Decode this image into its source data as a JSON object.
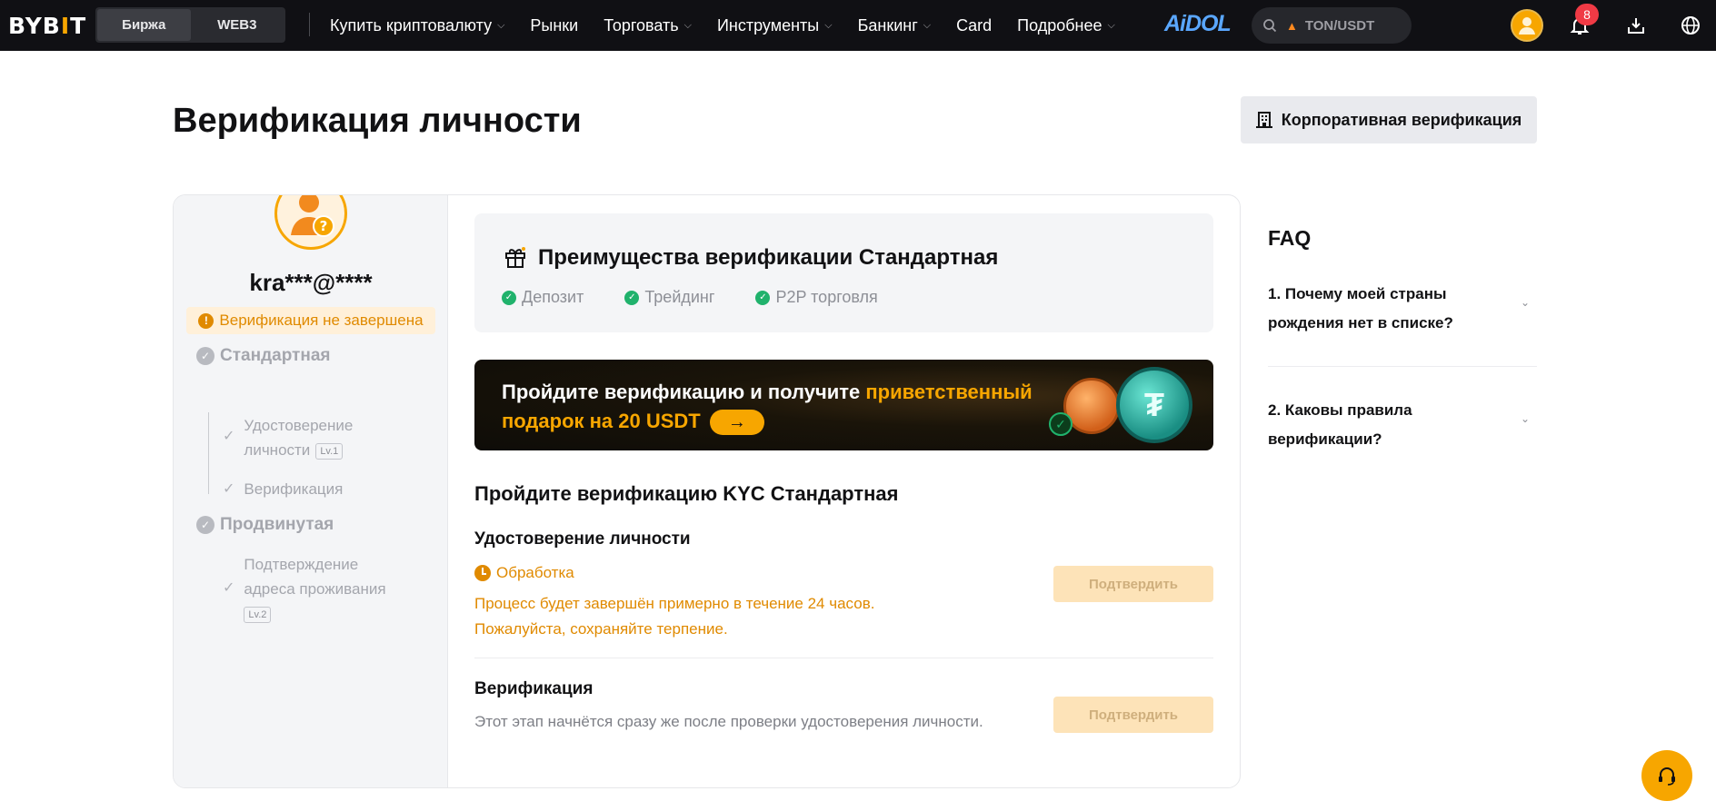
{
  "topbar": {
    "logo_left": "BYB",
    "logo_mark": "I",
    "logo_right": "T",
    "segment": [
      "Биржа",
      "WEB3"
    ],
    "nav": [
      {
        "label": "Купить криптовалюту",
        "has_menu": true
      },
      {
        "label": "Рынки",
        "has_menu": false
      },
      {
        "label": "Торговать",
        "has_menu": true
      },
      {
        "label": "Инструменты",
        "has_menu": true
      },
      {
        "label": "Банкинг",
        "has_menu": true
      },
      {
        "label": "Card",
        "has_menu": false
      },
      {
        "label": "Подробнее",
        "has_menu": true
      }
    ],
    "aidol": "AiDOL",
    "search_value": "TON/USDT",
    "notification_count": "8"
  },
  "page": {
    "title": "Верификация личности",
    "corporate_button": "Корпоративная верификация"
  },
  "sidebar": {
    "username": "kra***@****",
    "status": "Верификация не завершена",
    "levels": [
      {
        "label": "Стандартная"
      },
      {
        "label": "Продвинутая"
      }
    ],
    "substeps": {
      "identity_line1": "Удостоверение",
      "identity_line2": "личности",
      "identity_badge": "Lv.1",
      "verification": "Верификация",
      "address_line1": "Подтверждение",
      "address_line2": "адреса проживания",
      "address_badge": "Lv.2"
    }
  },
  "benefits": {
    "title": "Преимущества верификации Стандартная",
    "perks": [
      "Депозит",
      "Трейдинг",
      "P2P торговля"
    ]
  },
  "promo": {
    "text_plain": "Пройдите верификацию и получите ",
    "text_highlight": "приветственный подарок на 20 USDT"
  },
  "kyc": {
    "title": "Пройдите верификацию KYC Стандартная",
    "identity": {
      "title": "Удостоверение личности",
      "status": "Обработка",
      "note_line1": "Процесс будет завершён примерно в течение 24 часов.",
      "note_line2": "Пожалуйста, сохраняйте терпение.",
      "button": "Подтвердить"
    },
    "verification": {
      "title": "Верификация",
      "note": "Этот этап начнётся сразу же после проверки удостоверения личности.",
      "button": "Подтвердить"
    }
  },
  "faq": {
    "title": "FAQ",
    "items": [
      {
        "q": "1. Почему моей страны рождения нет в списке?"
      },
      {
        "q": "2. Каковы правила верификации?"
      }
    ]
  },
  "colors": {
    "accent": "#f7a600",
    "topbar": "#101014",
    "success": "#20b26c",
    "warning": "#e08a00"
  }
}
